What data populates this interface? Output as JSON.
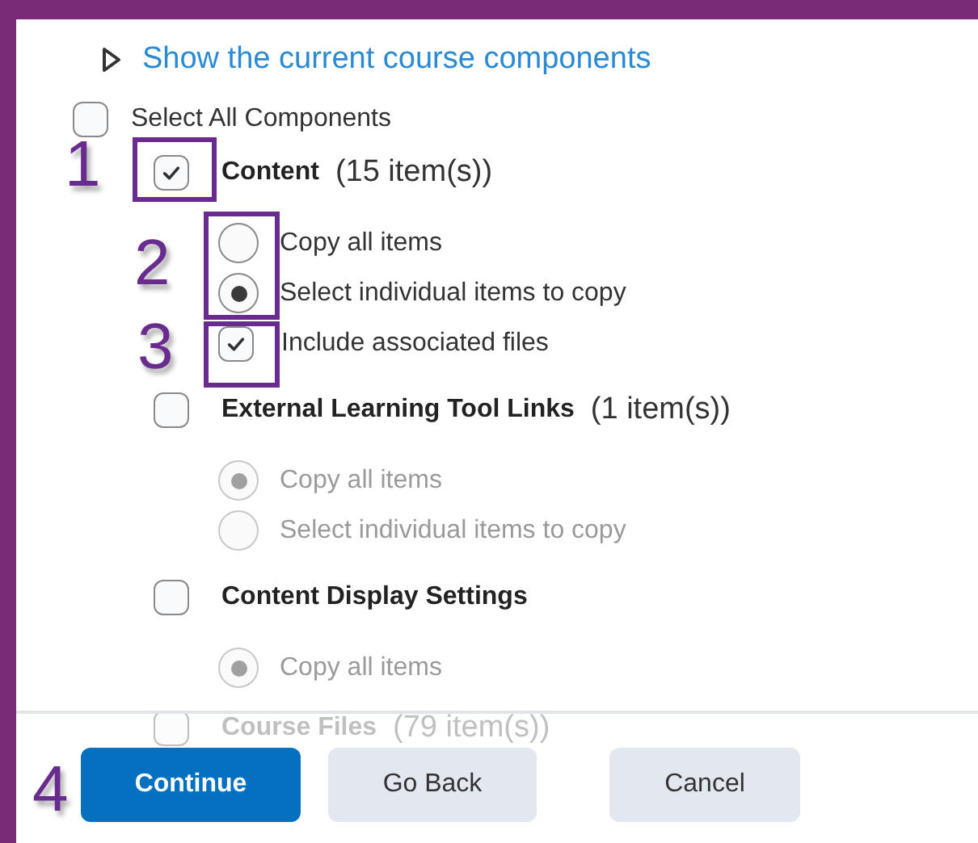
{
  "link": {
    "label": "Show the current course components"
  },
  "select_all": {
    "label": "Select All Components",
    "checked": false
  },
  "components": [
    {
      "name": "Content",
      "count": "(15 item(s))",
      "checked": true,
      "options": [
        {
          "label": "Copy all items",
          "selected": false,
          "disabled": false
        },
        {
          "label": "Select individual items to copy",
          "selected": true,
          "disabled": false
        }
      ],
      "include_files": {
        "label": "Include associated files",
        "checked": true
      }
    },
    {
      "name": "External Learning Tool Links",
      "count": "(1 item(s))",
      "checked": false,
      "options": [
        {
          "label": "Copy all items",
          "selected": true,
          "disabled": true
        },
        {
          "label": "Select individual items to copy",
          "selected": false,
          "disabled": true
        }
      ]
    },
    {
      "name": "Content Display Settings",
      "checked": false,
      "options": [
        {
          "label": "Copy all items",
          "selected": true,
          "disabled": true
        }
      ]
    },
    {
      "name": "Course Files",
      "count": "(79 item(s))",
      "checked": false,
      "faded": true
    }
  ],
  "buttons": [
    {
      "label": "Continue",
      "kind": "primary"
    },
    {
      "label": "Go Back",
      "kind": "secondary"
    },
    {
      "label": "Cancel",
      "kind": "secondary"
    }
  ],
  "annotations": [
    {
      "number": "1"
    },
    {
      "number": "2"
    },
    {
      "number": "3"
    },
    {
      "number": "4"
    }
  ]
}
